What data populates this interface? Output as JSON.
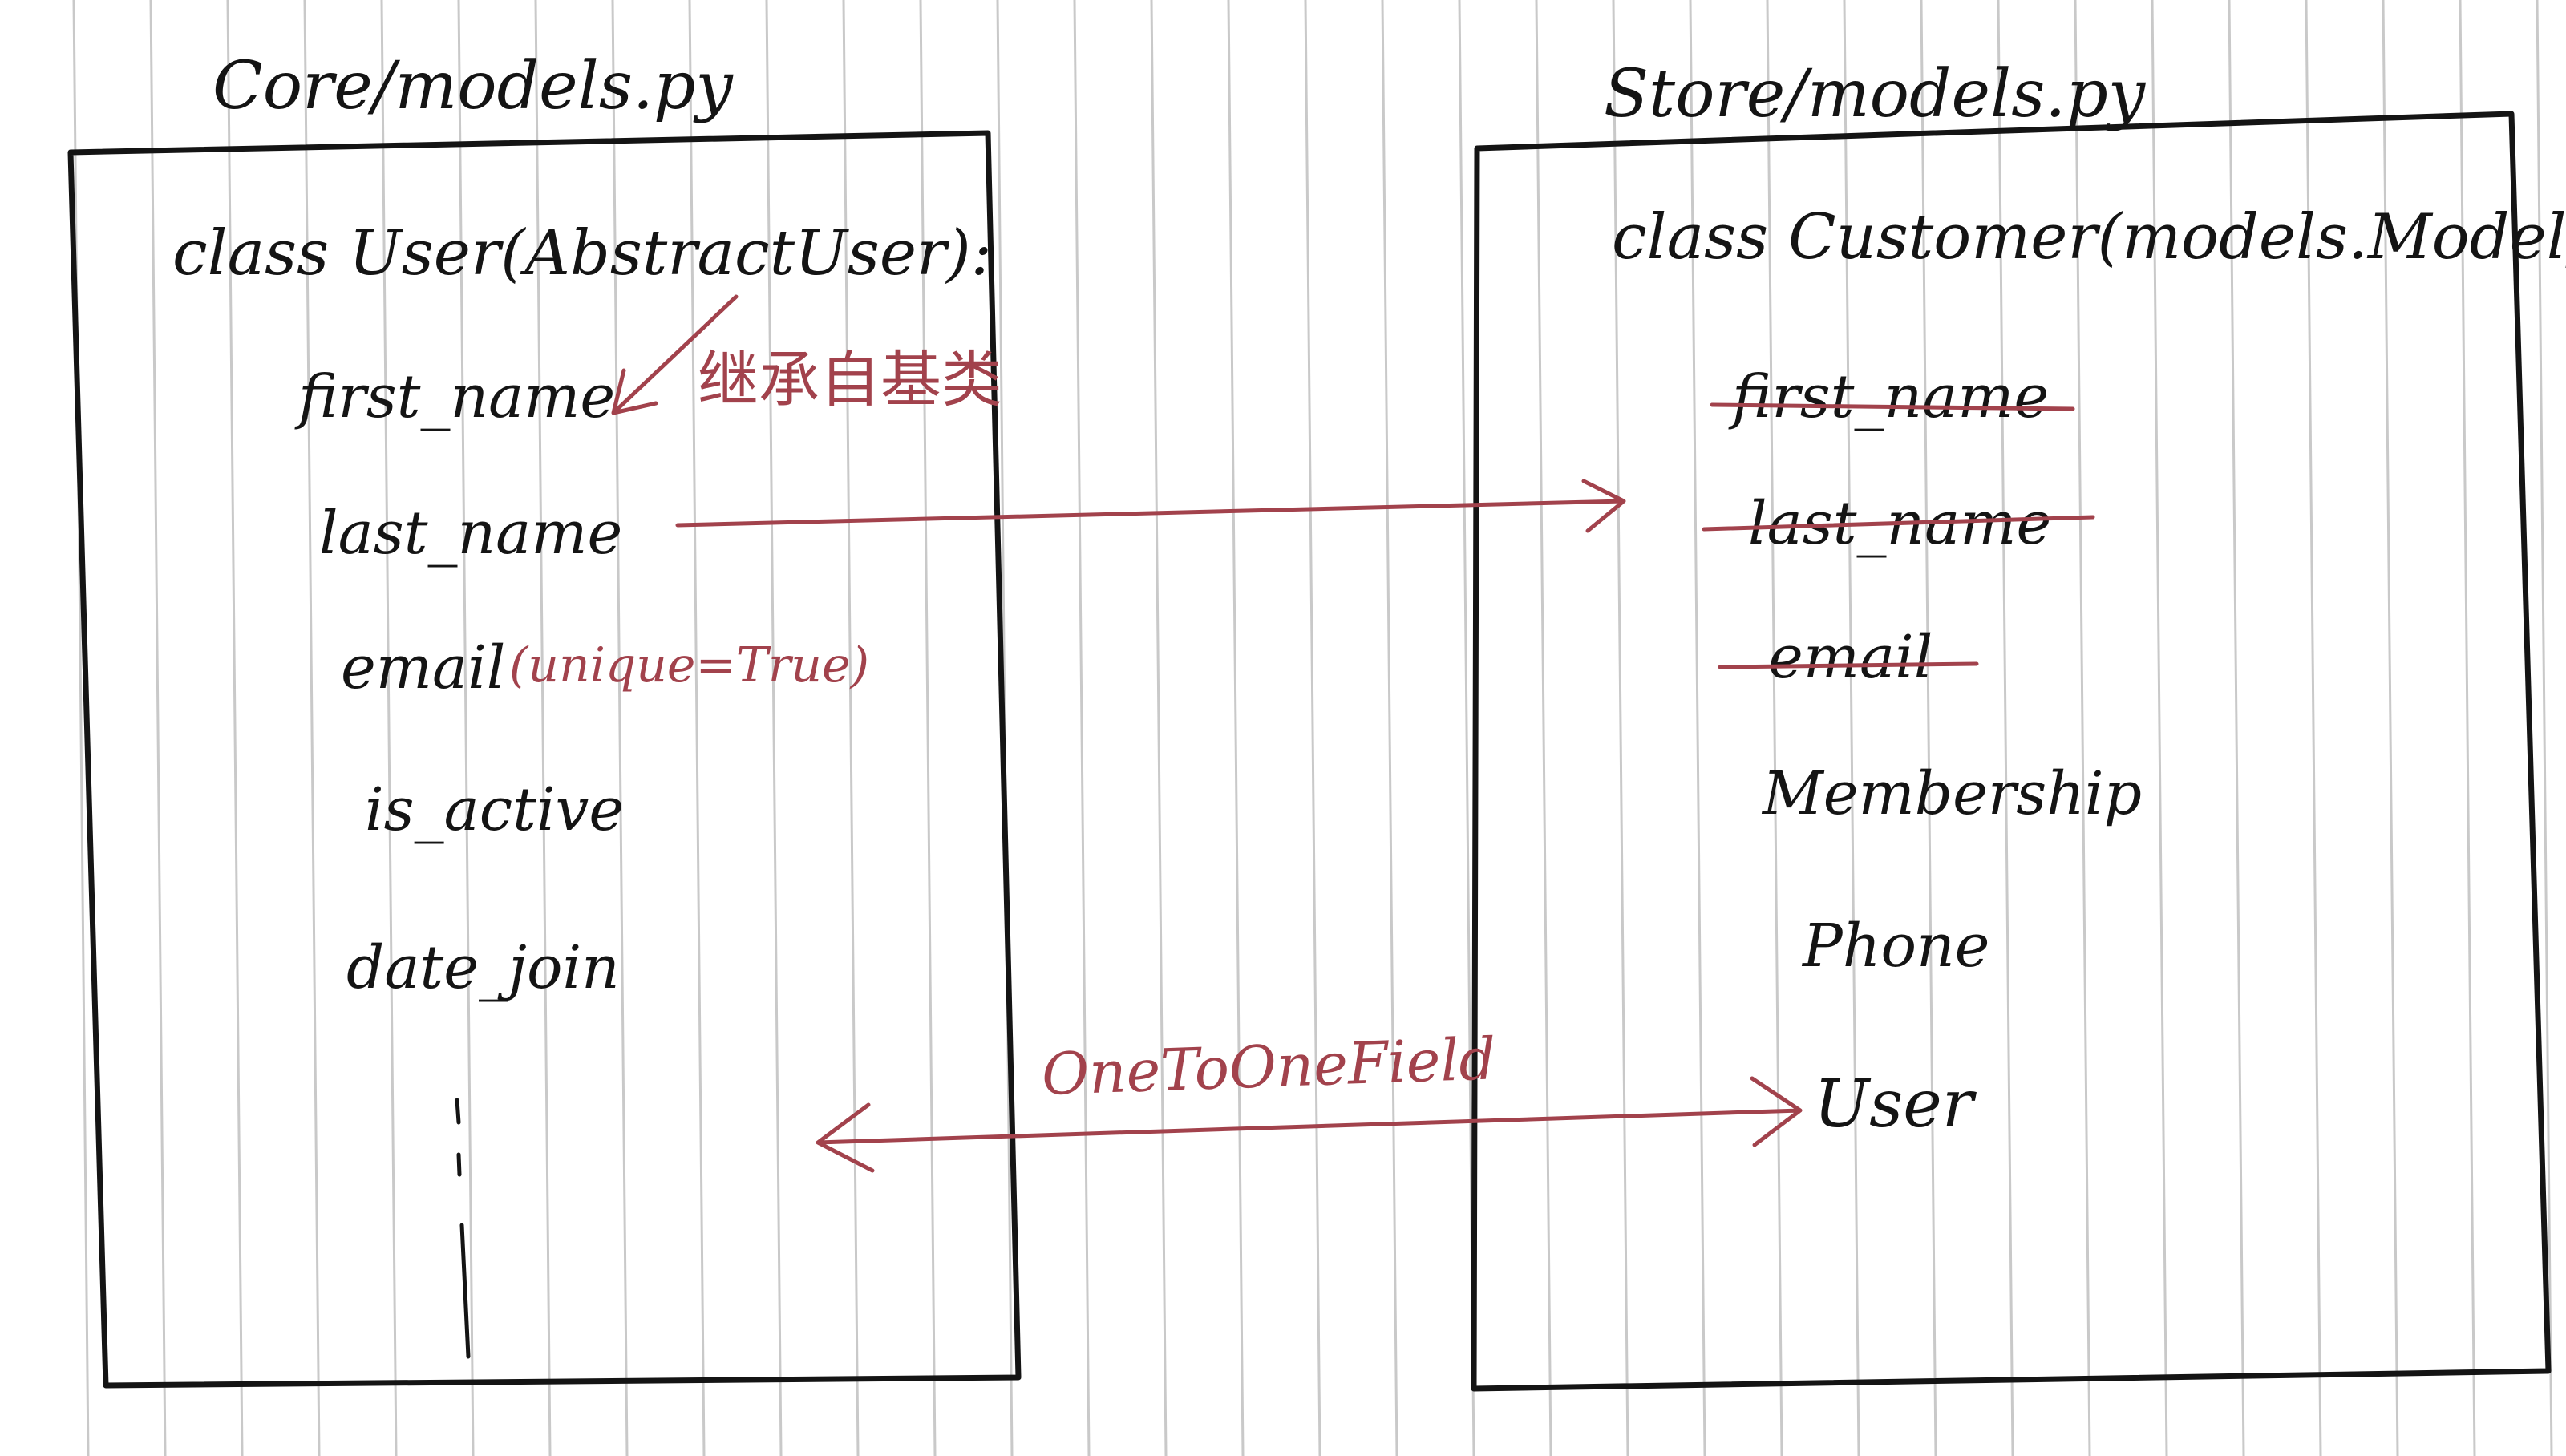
{
  "files": {
    "left": "Core/models.py",
    "right": "Store/models.py"
  },
  "left_class": {
    "declaration": "class User(AbstractUser):",
    "inherited_note": "继承自基类",
    "fields": [
      {
        "name": "first_name"
      },
      {
        "name": "last_name"
      },
      {
        "name": "email",
        "note": "(unique=True)"
      },
      {
        "name": "is_active"
      },
      {
        "name": "date_join"
      }
    ],
    "ellipsis": "⋮"
  },
  "right_class": {
    "declaration": "class Customer(models.Model):",
    "fields": [
      {
        "name": "first_name",
        "struck": true
      },
      {
        "name": "last_name",
        "struck": true
      },
      {
        "name": "email",
        "struck": true
      },
      {
        "name": "Membership",
        "struck": false
      },
      {
        "name": "Phone",
        "struck": false
      },
      {
        "name": "User",
        "struck": false
      }
    ]
  },
  "relation": {
    "label": "OneToOneField"
  },
  "colors": {
    "ink": "#141414",
    "annotation": "#a2424c",
    "rule_lines": "#c9c9c9",
    "paper": "#ffffff"
  }
}
